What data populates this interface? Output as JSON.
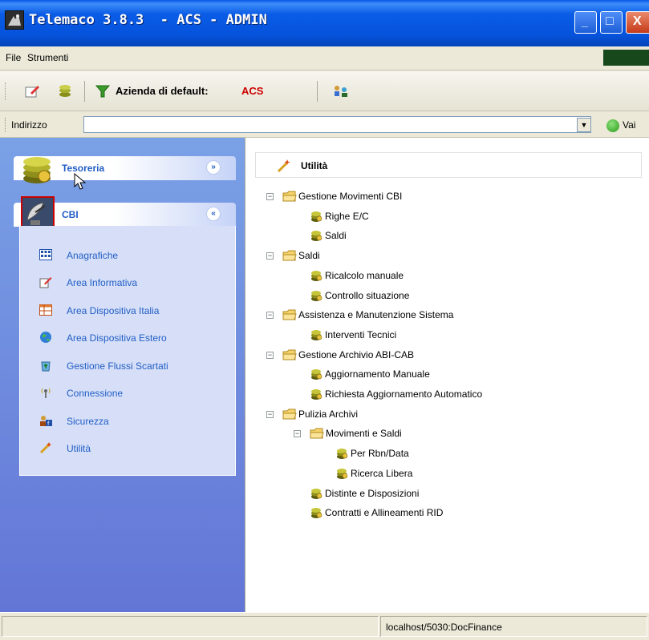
{
  "window": {
    "title": "Telemaco 3.8.3  - ACS - ADMIN",
    "minimize_glyph": "_",
    "maximize_glyph": "□",
    "close_glyph": "X"
  },
  "menubar": {
    "items": [
      {
        "label": "File"
      },
      {
        "label": "Strumenti"
      }
    ]
  },
  "toolbar": {
    "company_label": "Azienda di default: ",
    "company_value": "ACS",
    "accent_color": "#cc0000",
    "icons": [
      "edit-note-icon",
      "coins-icon",
      "filter-funnel-icon",
      "users-network-icon"
    ]
  },
  "address": {
    "label": "Indirizzo",
    "value": "",
    "dropdown_glyph": "▼",
    "go_label": "Vai"
  },
  "sidebar": {
    "groups": [
      {
        "label": "Tesoreria",
        "icon": "coins-stack-icon",
        "collapsed": true,
        "chevron": "»"
      },
      {
        "label": "CBI",
        "icon": "satellite-dish-icon",
        "collapsed": false,
        "chevron": "«"
      }
    ],
    "items": [
      {
        "label": "Anagrafiche",
        "icon": "grid-table-icon"
      },
      {
        "label": "Area Informativa",
        "icon": "edit-note-icon"
      },
      {
        "label": "Area Dispositiva Italia",
        "icon": "table-icon"
      },
      {
        "label": "Area Dispositiva Estero",
        "icon": "globe-icon"
      },
      {
        "label": "Gestione Flussi Scartati",
        "icon": "recycle-icon"
      },
      {
        "label": "Connessione",
        "icon": "antenna-icon"
      },
      {
        "label": "Sicurezza",
        "icon": "user-key-icon"
      },
      {
        "label": "Utilità",
        "icon": "magic-wand-icon"
      }
    ]
  },
  "content": {
    "header_label": "Utilità",
    "tree": [
      {
        "label": "Gestione Movimenti CBI",
        "type": "folder",
        "expanded": true,
        "level": 0
      },
      {
        "label": "Righe E/C",
        "type": "leaf",
        "level": 1
      },
      {
        "label": "Saldi",
        "type": "leaf",
        "level": 1
      },
      {
        "label": "Saldi",
        "type": "folder",
        "expanded": true,
        "level": 0
      },
      {
        "label": "Ricalcolo manuale",
        "type": "leaf",
        "level": 1
      },
      {
        "label": "Controllo situazione",
        "type": "leaf",
        "level": 1
      },
      {
        "label": "Assistenza e Manutenzione Sistema",
        "type": "folder",
        "expanded": true,
        "level": 0
      },
      {
        "label": "Interventi Tecnici",
        "type": "leaf",
        "level": 1
      },
      {
        "label": "Gestione Archivio ABI-CAB",
        "type": "folder",
        "expanded": true,
        "level": 0
      },
      {
        "label": "Aggiornamento Manuale",
        "type": "leaf",
        "level": 1
      },
      {
        "label": "Richiesta Aggiornamento Automatico",
        "type": "leaf",
        "level": 1
      },
      {
        "label": "Pulizia Archivi",
        "type": "folder",
        "expanded": true,
        "level": 0
      },
      {
        "label": "Movimenti e Saldi",
        "type": "folder",
        "expanded": true,
        "level": 1
      },
      {
        "label": "Per Rbn/Data",
        "type": "leaf",
        "level": 2
      },
      {
        "label": "Ricerca Libera",
        "type": "leaf",
        "level": 2
      },
      {
        "label": "Distinte e Disposizioni",
        "type": "leaf",
        "level": 1
      },
      {
        "label": "Contratti e Allineamenti RID",
        "type": "leaf",
        "level": 1
      }
    ]
  },
  "statusbar": {
    "left_text": "",
    "connection": "localhost/5030:DocFinance"
  }
}
